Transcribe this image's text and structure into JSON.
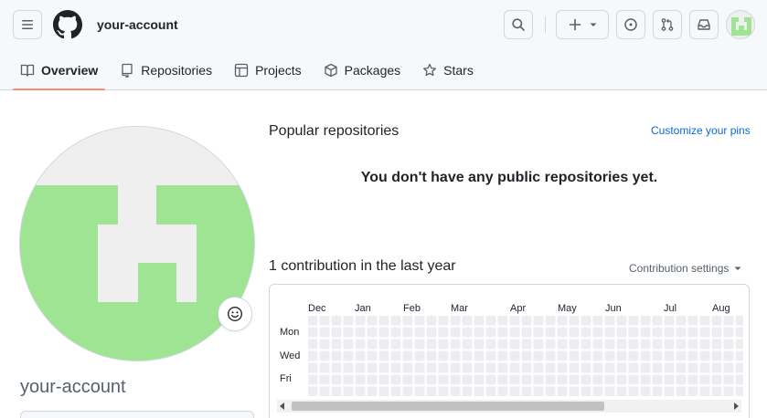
{
  "header": {
    "account_name": "your-account",
    "icons": {
      "menu": "hamburger-icon",
      "logo": "github-logo",
      "search": "search-icon",
      "create": "plus-icon",
      "issues": "issue-circle-icon",
      "pulls": "pull-request-icon",
      "inbox": "inbox-icon"
    }
  },
  "tabs": [
    {
      "label": "Overview",
      "icon": "book-icon",
      "selected": true
    },
    {
      "label": "Repositories",
      "icon": "repo-icon",
      "selected": false
    },
    {
      "label": "Projects",
      "icon": "table-icon",
      "selected": false
    },
    {
      "label": "Packages",
      "icon": "package-icon",
      "selected": false
    },
    {
      "label": "Stars",
      "icon": "star-icon",
      "selected": false
    }
  ],
  "profile": {
    "name": "your-account",
    "avatar_color": "#9ee493"
  },
  "popular": {
    "title": "Popular repositories",
    "customize_label": "Customize your pins",
    "empty_message": "You don't have any public repositories yet."
  },
  "contributions": {
    "title": "1 contribution in the last year",
    "settings_label": "Contribution settings",
    "months": [
      "Dec",
      "Jan",
      "Feb",
      "Mar",
      "Apr",
      "May",
      "Jun",
      "Jul",
      "Aug"
    ],
    "days": [
      "Mon",
      "Wed",
      "Fri"
    ]
  },
  "colors": {
    "accent_link": "#0969da",
    "tab_underline": "#fd8c73",
    "empty_cell": "#ebedf0"
  }
}
